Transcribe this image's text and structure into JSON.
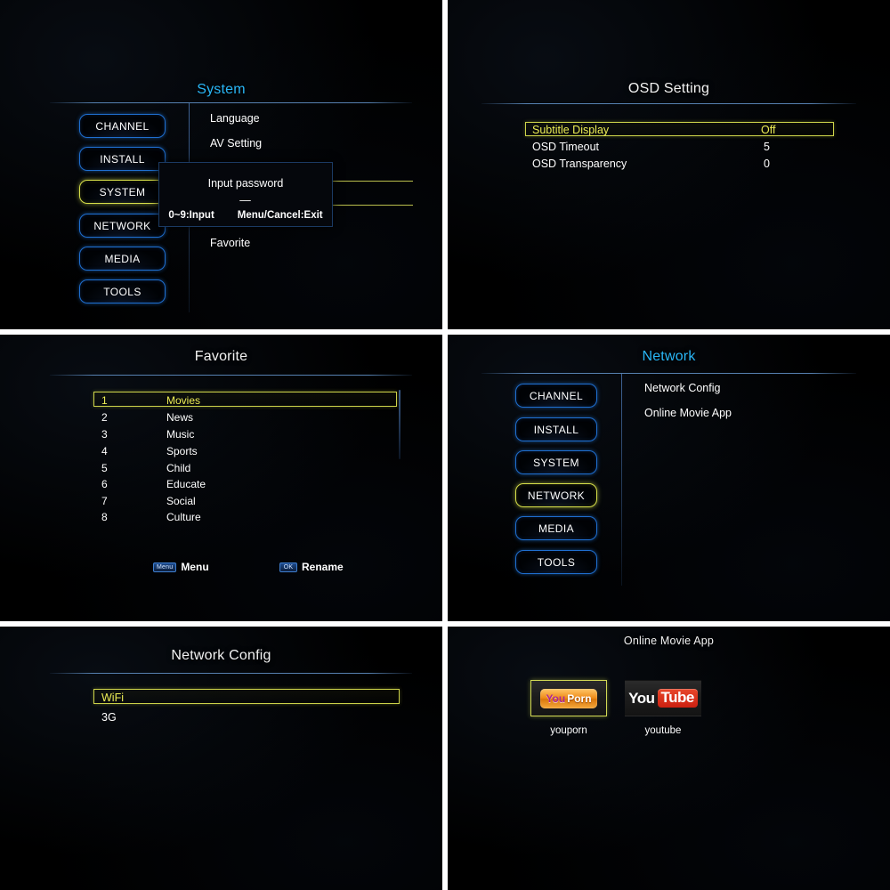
{
  "common": {
    "nav_items": [
      "CHANNEL",
      "INSTALL",
      "SYSTEM",
      "NETWORK",
      "MEDIA",
      "TOOLS"
    ],
    "colors": {
      "title_cyan": "#29b6f6",
      "title_white": "#f2f2f2",
      "nav_border": "#1f6fd0",
      "selected_border": "#d8e04a",
      "selected_text": "#eded55",
      "background": "#000000",
      "rule": "#5a87b9"
    }
  },
  "panel_system": {
    "title": "System",
    "nav": [
      {
        "label": "CHANNEL",
        "selected": false
      },
      {
        "label": "INSTALL",
        "selected": false
      },
      {
        "label": "SYSTEM",
        "selected": true
      },
      {
        "label": "NETWORK",
        "selected": false
      },
      {
        "label": "MEDIA",
        "selected": false
      },
      {
        "label": "TOOLS",
        "selected": false
      }
    ],
    "menu": [
      {
        "label": "Language"
      },
      {
        "label": "AV Setting"
      },
      {
        "label": "Favorite"
      }
    ],
    "dialog": {
      "title": "Input password",
      "value": "—",
      "hint_left": "0~9:Input",
      "hint_right": "Menu/Cancel:Exit"
    }
  },
  "panel_osd": {
    "title": "OSD Setting",
    "rows": [
      {
        "label": "Subtitle Display",
        "value": "Off",
        "selected": true
      },
      {
        "label": "OSD Timeout",
        "value": "5",
        "selected": false
      },
      {
        "label": "OSD Transparency",
        "value": "0",
        "selected": false
      }
    ]
  },
  "panel_favorite": {
    "title": "Favorite",
    "items": [
      {
        "num": "1",
        "name": "Movies",
        "selected": true
      },
      {
        "num": "2",
        "name": "News",
        "selected": false
      },
      {
        "num": "3",
        "name": "Music",
        "selected": false
      },
      {
        "num": "4",
        "name": "Sports",
        "selected": false
      },
      {
        "num": "5",
        "name": "Child",
        "selected": false
      },
      {
        "num": "6",
        "name": "Educate",
        "selected": false
      },
      {
        "num": "7",
        "name": "Social",
        "selected": false
      },
      {
        "num": "8",
        "name": "Culture",
        "selected": false
      }
    ],
    "hints": [
      {
        "key": "Menu",
        "action": "Menu"
      },
      {
        "key": "OK",
        "action": "Rename"
      }
    ]
  },
  "panel_network": {
    "title": "Network",
    "nav": [
      {
        "label": "CHANNEL",
        "selected": false
      },
      {
        "label": "INSTALL",
        "selected": false
      },
      {
        "label": "SYSTEM",
        "selected": false
      },
      {
        "label": "NETWORK",
        "selected": true
      },
      {
        "label": "MEDIA",
        "selected": false
      },
      {
        "label": "TOOLS",
        "selected": false
      }
    ],
    "menu": [
      {
        "label": "Network Config"
      },
      {
        "label": "Online Movie App"
      }
    ]
  },
  "panel_netconfig": {
    "title": "Network Config",
    "rows": [
      {
        "label": "WiFi",
        "selected": true
      },
      {
        "label": "3G",
        "selected": false
      }
    ]
  },
  "panel_apps": {
    "title": "Online Movie App",
    "apps": [
      {
        "label": "youporn",
        "logo": "youporn-logo",
        "logo_part1": "You",
        "logo_part2": "Porn",
        "selected": true
      },
      {
        "label": "youtube",
        "logo": "youtube-logo",
        "logo_part1": "You",
        "logo_part2": "Tube",
        "selected": false
      }
    ]
  }
}
